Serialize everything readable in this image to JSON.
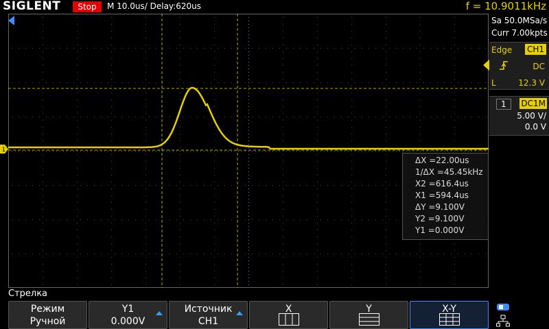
{
  "header": {
    "brand": "SIGLENT",
    "run_status": "Stop",
    "timebase": "M 10.0us/",
    "delay": "Delay:620us",
    "frequency": "f = 10.9011kHz"
  },
  "acquisition": {
    "sample_rate": "Sa 50.0MSa/s",
    "memory_depth": "Curr 7.00kpts"
  },
  "trigger": {
    "type": "Edge",
    "source": "CH1",
    "slope_icon": "rising-edge-icon",
    "coupling": "DC",
    "level_label": "L",
    "level": "12.3 V"
  },
  "channel1": {
    "number": "1",
    "coupling": "DC1M",
    "scale": "5.00 V/",
    "offset": "0.0 V",
    "marker": "1",
    "color": "#e8d000"
  },
  "measurements": {
    "delta_x": "ΔX =22.00us",
    "inv_delta_x": "1/ΔX =45.45kHz",
    "x2": "X2 =616.4us",
    "x1": "X1 =594.4us",
    "delta_y": "ΔY =9.100V",
    "y2": "Y2 =9.100V",
    "y1": "Y1 =0.000V"
  },
  "menu": {
    "title": "Стрелка",
    "softkeys": [
      {
        "line1": "Режим",
        "line2": "Ручной"
      },
      {
        "line1": "Y1",
        "line2": "0.000V"
      },
      {
        "line1": "Источник",
        "line2": "CH1"
      },
      {
        "line1": "X",
        "line2": ""
      },
      {
        "line1": "Y",
        "line2": ""
      },
      {
        "line1": "X-Y",
        "line2": ""
      }
    ]
  },
  "colors": {
    "trace": "#e8d000",
    "stop": "#e00000",
    "selected": "#3c8cff"
  }
}
